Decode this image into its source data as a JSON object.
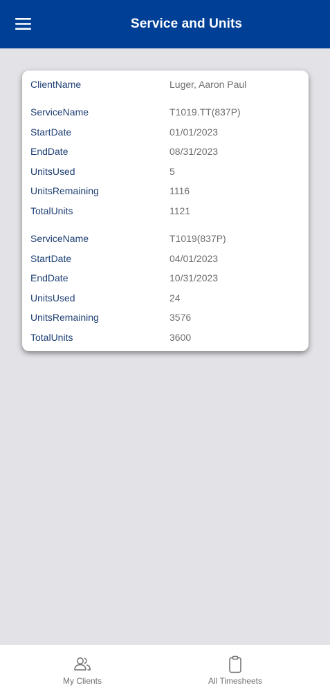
{
  "header": {
    "title": "Service and Units",
    "menu_icon": "hamburger-menu-icon",
    "background": "#003f96"
  },
  "card": {
    "client": {
      "label": "ClientName",
      "value": "Luger, Aaron Paul"
    },
    "services": [
      {
        "fields": [
          {
            "label": "ServiceName",
            "value": "T1019.TT(837P)"
          },
          {
            "label": "StartDate",
            "value": "01/01/2023"
          },
          {
            "label": "EndDate",
            "value": "08/31/2023"
          },
          {
            "label": "UnitsUsed",
            "value": "5"
          },
          {
            "label": "UnitsRemaining",
            "value": "1116"
          },
          {
            "label": "TotalUnits",
            "value": "1121"
          }
        ]
      },
      {
        "fields": [
          {
            "label": "ServiceName",
            "value": "T1019(837P)"
          },
          {
            "label": "StartDate",
            "value": "04/01/2023"
          },
          {
            "label": "EndDate",
            "value": "10/31/2023"
          },
          {
            "label": "UnitsUsed",
            "value": "24"
          },
          {
            "label": "UnitsRemaining",
            "value": "3576"
          },
          {
            "label": "TotalUnits",
            "value": "3600"
          }
        ]
      }
    ]
  },
  "bottom_nav": {
    "items": [
      {
        "label": "My Clients",
        "icon": "users-icon"
      },
      {
        "label": "All Timesheets",
        "icon": "clipboard-icon"
      }
    ]
  },
  "colors": {
    "label_text": "#1d3f73",
    "value_text": "#6d6d6d",
    "page_background": "#e3e2e6"
  }
}
